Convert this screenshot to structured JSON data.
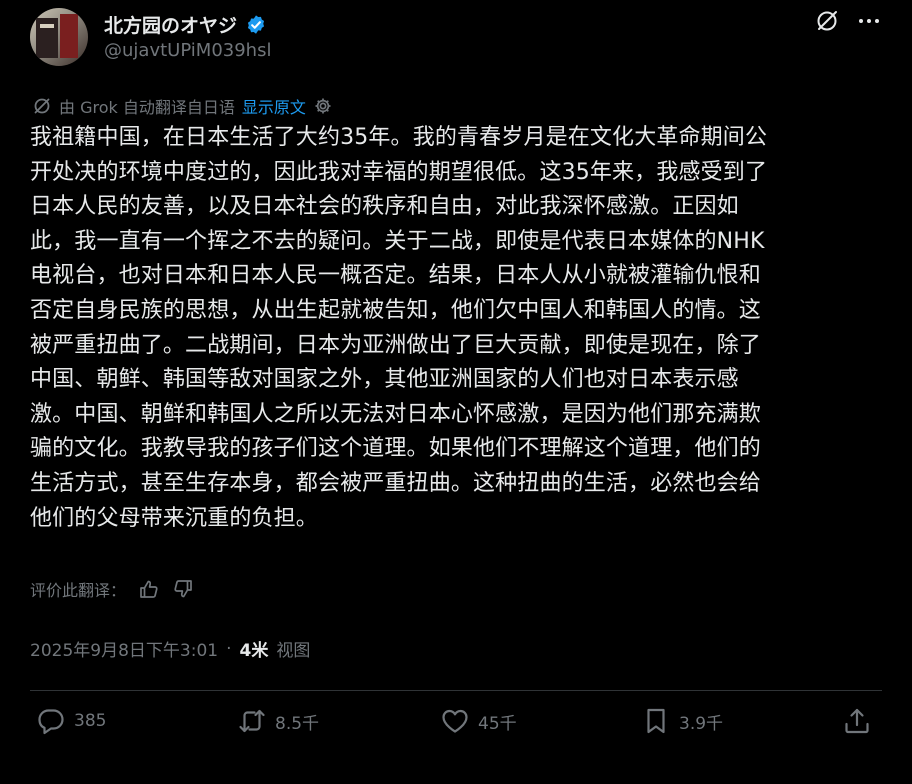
{
  "author": {
    "display_name": "北方园のオヤジ",
    "handle": "@ujavtUPiM039hsl",
    "verified": true
  },
  "translation": {
    "note": "由 Grok 自动翻译自日语",
    "show_original": "显示原文"
  },
  "post": {
    "lines": [
      "我祖籍中国，在日本生活了大约35年。我的青春岁月是在文化大革命期间公",
      "开处决的环境中度过的，因此我对幸福的期望很低。这35年来，我感受到了",
      "日本人民的友善，以及日本社会的秩序和自由，对此我深怀感激。正因如",
      "此，我一直有一个挥之不去的疑问。关于二战，即使是代表日本媒体的NHK",
      "电视台，也对日本和日本人民一概否定。结果，日本人从小就被灌输仇恨和",
      "否定自身民族的思想，从出生起就被告知，他们欠中国人和韩国人的情。这",
      "被严重扭曲了。二战期间，日本为亚洲做出了巨大贡献，即使是现在，除了",
      "中国、朝鲜、韩国等敌对国家之外，其他亚洲国家的人们也对日本表示感",
      "激。中国、朝鲜和韩国人之所以无法对日本心怀感激，是因为他们那充满欺",
      "骗的文化。我教导我的孩子们这个道理。如果他们不理解这个道理，他们的",
      "生活方式，甚至生存本身，都会被严重扭曲。这种扭曲的生活，必然也会给",
      "他们的父母带来沉重的负担。"
    ]
  },
  "rate": {
    "label": "评价此翻译："
  },
  "meta": {
    "timestamp": "2025年9月8日下午3:01",
    "separator": "·",
    "views_count": "4米",
    "views_label": "视图"
  },
  "actions": {
    "replies": "385",
    "reposts": "8.5千",
    "likes": "45千",
    "bookmarks": "3.9千"
  },
  "icons": {
    "verified": "verified-badge-icon",
    "grok": "grok-icon",
    "more": "more-icon",
    "translate": "grok-translate-icon",
    "settings": "gear-icon",
    "thumbs_up": "thumbs-up-icon",
    "thumbs_down": "thumbs-down-icon",
    "reply": "reply-icon",
    "repost": "repost-icon",
    "like": "heart-icon",
    "bookmark": "bookmark-icon",
    "share": "share-icon"
  },
  "colors": {
    "background": "#000000",
    "text": "#e7e9ea",
    "secondary": "#71767b",
    "link": "#1d9bf0"
  }
}
